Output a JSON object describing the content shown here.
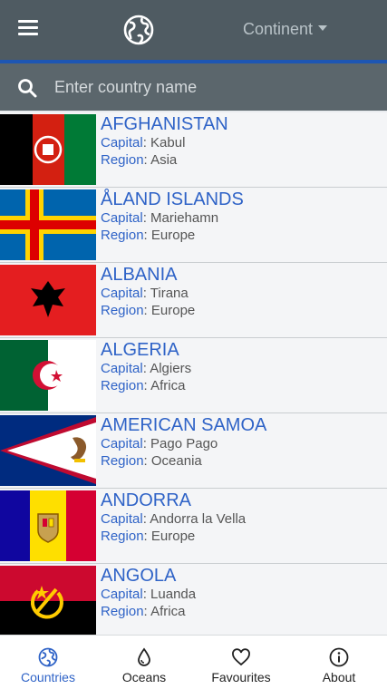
{
  "header": {
    "continent_label": "Continent"
  },
  "search": {
    "placeholder": "Enter country name"
  },
  "labels": {
    "capital": "Capital",
    "region": "Region"
  },
  "countries": [
    {
      "name": "AFGHANISTAN",
      "capital": "Kabul",
      "region": "Asia"
    },
    {
      "name": "ÅLAND ISLANDS",
      "capital": "Mariehamn",
      "region": "Europe"
    },
    {
      "name": "ALBANIA",
      "capital": "Tirana",
      "region": "Europe"
    },
    {
      "name": "ALGERIA",
      "capital": "Algiers",
      "region": "Africa"
    },
    {
      "name": "AMERICAN SAMOA",
      "capital": "Pago Pago",
      "region": "Oceania"
    },
    {
      "name": "ANDORRA",
      "capital": "Andorra la Vella",
      "region": "Europe"
    },
    {
      "name": "ANGOLA",
      "capital": "Luanda",
      "region": "Africa"
    }
  ],
  "nav": {
    "countries": "Countries",
    "oceans": "Oceans",
    "favourites": "Favourites",
    "about": "About"
  },
  "colors": {
    "header_bg": "#4f5b62",
    "accent": "#2f63c7"
  }
}
